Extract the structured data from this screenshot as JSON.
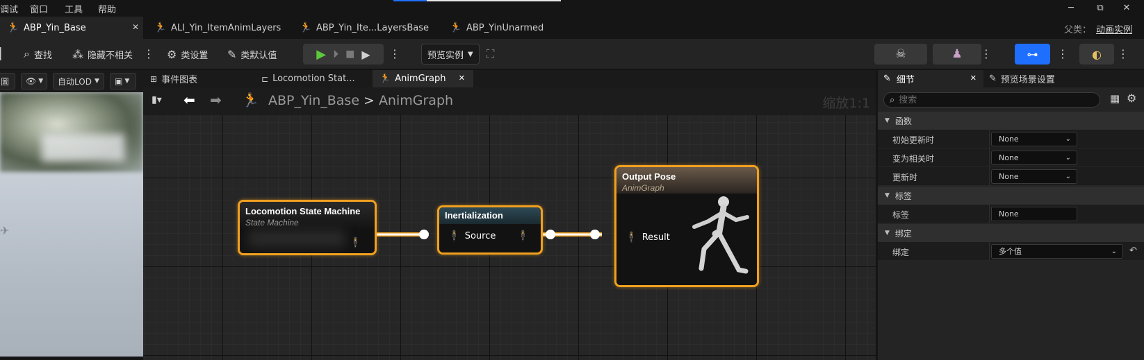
{
  "menu": [
    "调试",
    "窗口",
    "工具",
    "帮助"
  ],
  "window_controls": {
    "minimize": "─",
    "restore": "⧉",
    "close": "✕"
  },
  "asset_tabs": [
    {
      "label": "ABP_Yin_Base",
      "active": true
    },
    {
      "label": "ALI_Yin_ItemAnimLayers",
      "active": false
    },
    {
      "label": "ABP_Yin_Ite...LayersBase",
      "active": false
    },
    {
      "label": "ABP_YinUnarmed",
      "active": false
    }
  ],
  "parent_class": {
    "label": "父类：",
    "value": "动画实例"
  },
  "toolbar": {
    "find": "查找",
    "hide_unrelated": "隐藏不相关",
    "class_settings": "类设置",
    "class_defaults": "类默认值",
    "preview_instance": "预览实例"
  },
  "viewport_bar": {
    "view_mode": "圖",
    "lod": "自动LOD"
  },
  "graph_tabs": [
    {
      "label": "事件图表",
      "active": false
    },
    {
      "label": "Locomotion Stat...",
      "active": false
    },
    {
      "label": "AnimGraph",
      "active": true
    }
  ],
  "breadcrumb": {
    "root": "ABP_Yin_Base",
    "sep": ">",
    "current": "AnimGraph"
  },
  "zoom": "缩放1:1",
  "nodes": {
    "locomotion": {
      "title": "Locomotion State Machine",
      "subtitle": "State Machine"
    },
    "inertialization": {
      "title": "Inertialization",
      "pin": "Source"
    },
    "output": {
      "title": "Output Pose",
      "subtitle": "AnimGraph",
      "pin": "Result"
    }
  },
  "details": {
    "tabs": [
      {
        "label": "细节",
        "active": true
      },
      {
        "label": "预览场景设置",
        "active": false
      }
    ],
    "search_placeholder": "搜索",
    "sections": [
      {
        "title": "函数",
        "rows": [
          {
            "label": "初始更新时",
            "value": "None"
          },
          {
            "label": "变为相关时",
            "value": "None"
          },
          {
            "label": "更新时",
            "value": "None"
          }
        ]
      },
      {
        "title": "标签",
        "rows": [
          {
            "label": "标签",
            "value": "None"
          }
        ]
      },
      {
        "title": "绑定",
        "rows": [
          {
            "label": "绑定",
            "value": "多个值"
          }
        ]
      }
    ]
  },
  "colors": {
    "accent": "#f0a020",
    "selection": "#1f6fff",
    "background": "#151515"
  }
}
